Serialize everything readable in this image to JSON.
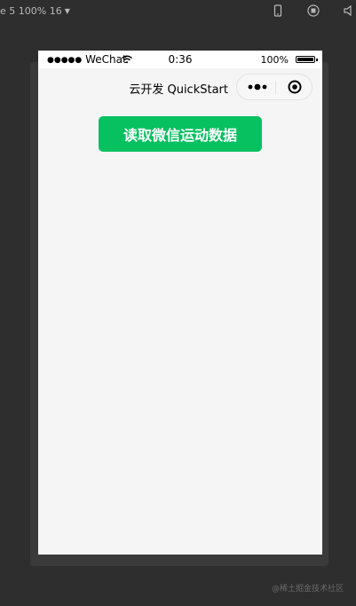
{
  "toolbar": {
    "device_label": "e 5 100% 16",
    "icons": [
      "phone-icon",
      "record-icon",
      "volume-icon"
    ]
  },
  "status_bar": {
    "signal_dots": "●●●●●",
    "carrier": "WeChat",
    "time": "0:36",
    "battery": "100%"
  },
  "nav": {
    "title": "云开发 QuickStart"
  },
  "main": {
    "button_label": "读取微信运动数据"
  },
  "watermark": "@稀土掘金技术社区",
  "colors": {
    "accent": "#07c160",
    "ide_background": "#2e2e2e",
    "page_background": "#f5f5f5"
  }
}
